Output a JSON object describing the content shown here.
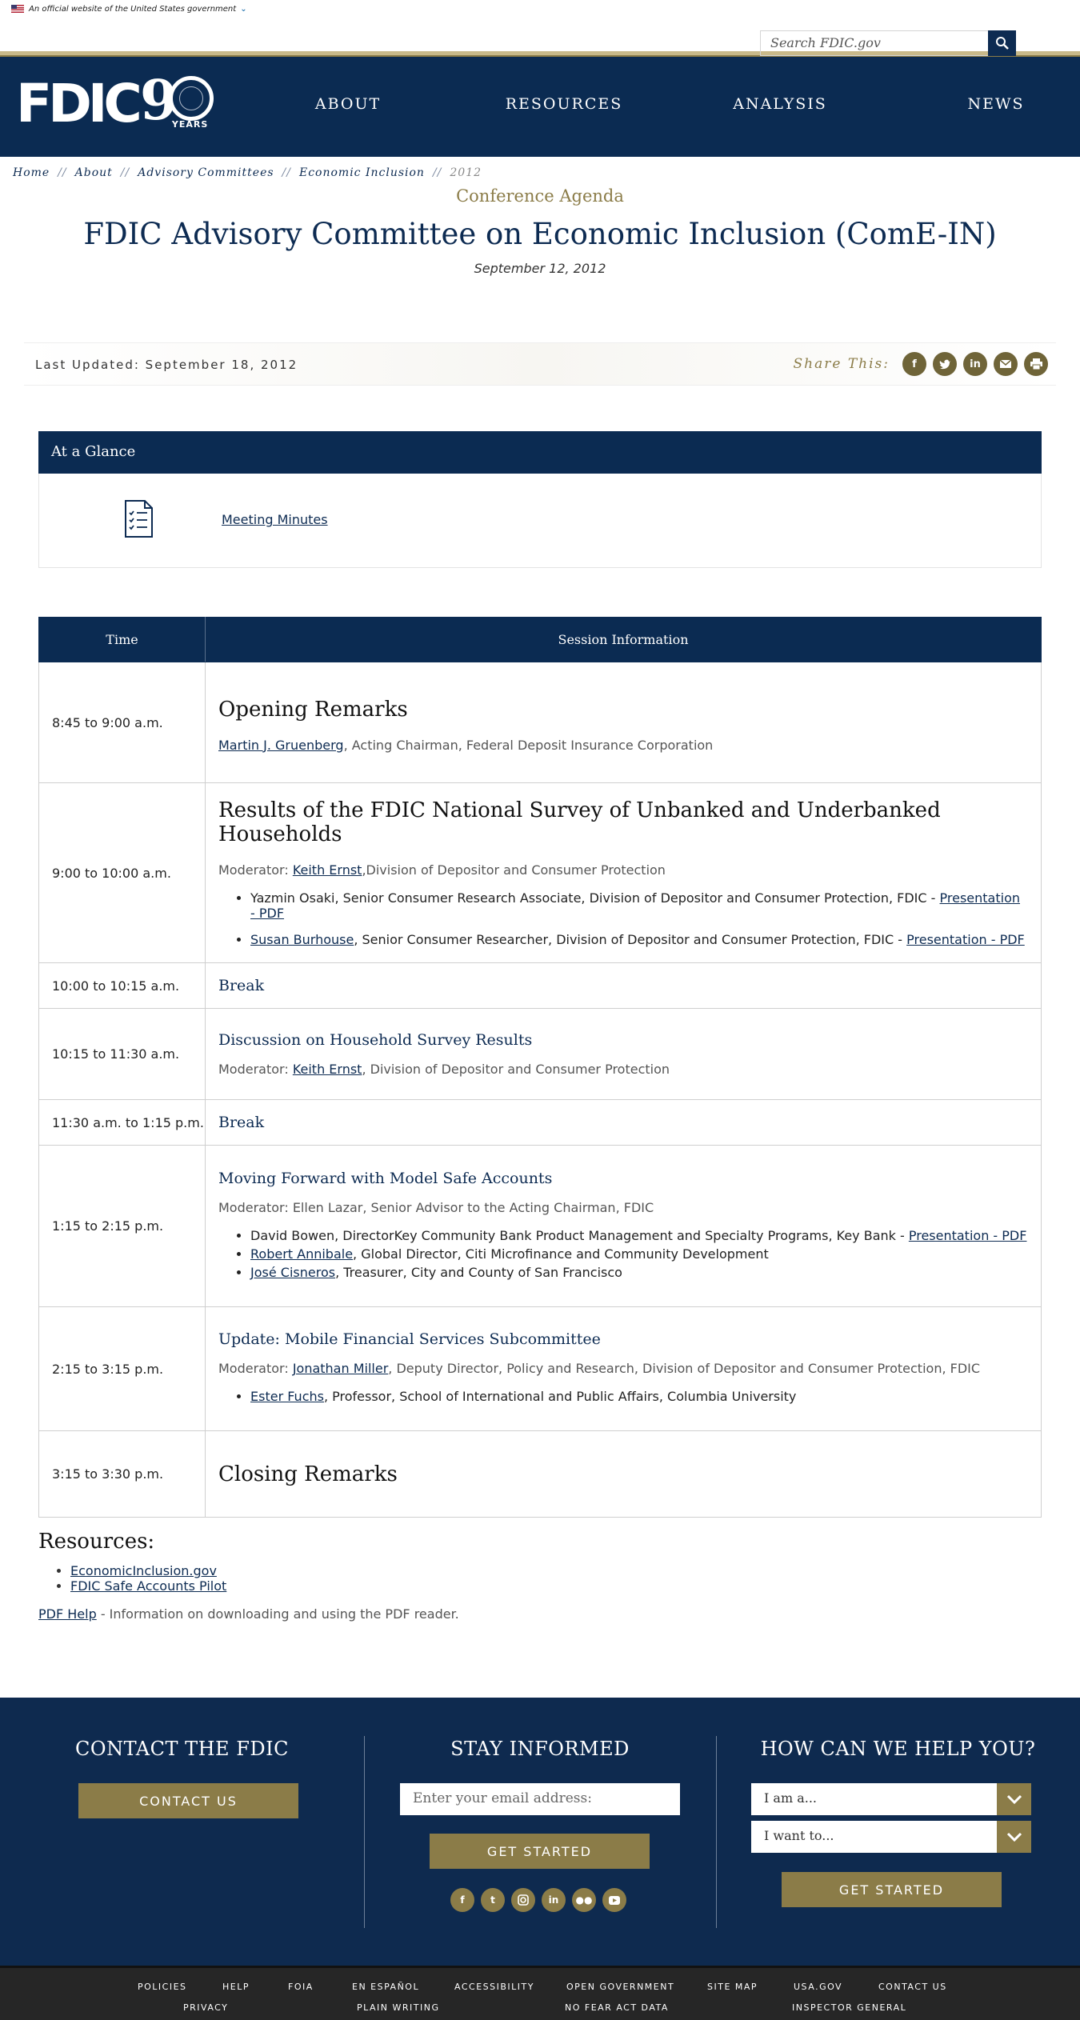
{
  "gov_banner": {
    "text": "An official website of the United States government"
  },
  "search": {
    "placeholder": "Search FDIC.gov"
  },
  "logo": {
    "text": "FDIC",
    "nine": "9",
    "years": "YEARS"
  },
  "nav": {
    "items": [
      "ABOUT",
      "RESOURCES",
      "ANALYSIS",
      "NEWS"
    ]
  },
  "breadcrumb": {
    "items": [
      "Home",
      "About",
      "Advisory Committees",
      "Economic Inclusion"
    ],
    "current": "2012",
    "separator": "//"
  },
  "page": {
    "kicker": "Conference Agenda",
    "title": "FDIC Advisory Committee on Economic Inclusion (ComE-IN)",
    "date": "September 12, 2012",
    "last_updated": "Last Updated: September 18, 2012",
    "share_label": "Share This:"
  },
  "share_icons": [
    "facebook-icon",
    "twitter-icon",
    "linkedin-icon",
    "email-icon",
    "print-icon"
  ],
  "glance": {
    "heading": "At a Glance",
    "link": "Meeting Minutes"
  },
  "agenda": {
    "col_time": "Time",
    "col_info": "Session Information",
    "rows": [
      {
        "time": "8:45 to 9:00 a.m.",
        "title": "Opening Remarks",
        "mod_link": "Martin J. Gruenberg",
        "mod_rest": ", Acting Chairman, Federal Deposit Insurance Corporation"
      },
      {
        "time": "9:00 to 10:00 a.m.",
        "title": "Results of the FDIC National Survey of Unbanked and Underbanked Households",
        "mod_pre": "Moderator: ",
        "mod_link": "Keith Ernst",
        "mod_rest": ",Division of Depositor and Consumer Protection",
        "bullets": [
          {
            "text": "Yazmin Osaki, Senior Consumer Research Associate, Division of Depositor and Consumer Protection, FDIC - ",
            "link2": "Presentation - PDF"
          },
          {
            "link1": "Susan Burhouse",
            "text": ", Senior Consumer Researcher, Division of Depositor and Consumer Protection, FDIC - ",
            "link2": "Presentation - PDF"
          }
        ]
      },
      {
        "time": "10:00 to 10:15 a.m.",
        "title": "Break"
      },
      {
        "time": "10:15 to 11:30 a.m.",
        "title": "Discussion on Household Survey Results",
        "mod_pre": "Moderator: ",
        "mod_link": "Keith Ernst",
        "mod_rest": ", Division of Depositor and Consumer Protection"
      },
      {
        "time": "11:30 a.m. to 1:15 p.m.",
        "title": "Break"
      },
      {
        "time": "1:15 to 2:15 p.m.",
        "title": "Moving Forward with Model Safe Accounts",
        "mod_text": "Moderator: Ellen Lazar, Senior Advisor to the Acting Chairman, FDIC",
        "bullets": [
          {
            "text": "David Bowen, DirectorKey Community Bank Product Management and Specialty Programs, Key Bank - ",
            "link2": "Presentation - PDF"
          },
          {
            "link1": "Robert Annibale",
            "text": ", Global Director, Citi Microfinance and Community Development"
          },
          {
            "link1": "José Cisneros",
            "text": ", Treasurer, City and County of San Francisco"
          }
        ]
      },
      {
        "time": "2:15 to 3:15 p.m.",
        "title": "Update: Mobile Financial Services Subcommittee",
        "mod_pre": "Moderator: ",
        "mod_link": "Jonathan Miller",
        "mod_rest": ", Deputy Director, Policy and Research, Division of Depositor and Consumer Protection, FDIC",
        "bullets": [
          {
            "link1": "Ester Fuchs",
            "text": ", Professor, School of International and Public Affairs, Columbia University"
          }
        ]
      },
      {
        "time": "3:15 to 3:30 p.m.",
        "title": "Closing Remarks"
      }
    ]
  },
  "resources": {
    "heading": "Resources:",
    "links": [
      "EconomicInclusion.gov",
      "FDIC Safe Accounts Pilot"
    ],
    "pdf_help_link": "PDF Help",
    "pdf_help_text": " - Information on downloading and using the PDF reader."
  },
  "footer": {
    "contact_heading": "CONTACT THE FDIC",
    "contact_button": "CONTACT US",
    "stay_heading": "STAY INFORMED",
    "email_placeholder": "Enter your email address:",
    "stay_button": "GET STARTED",
    "help_heading": "HOW CAN WE HELP YOU?",
    "select1": "I am a...",
    "select2": "I want to...",
    "help_button": "GET STARTED",
    "social": [
      "f",
      "t",
      "ig",
      "in",
      "fl",
      "yt"
    ]
  },
  "bottom_links": {
    "row1": [
      "POLICIES",
      "HELP",
      "FOIA",
      "EN ESPAÑOL",
      "ACCESSIBILITY",
      "OPEN GOVERNMENT",
      "SITE MAP",
      "USA.GOV",
      "CONTACT US"
    ],
    "row2": [
      "PRIVACY",
      "PLAIN WRITING",
      "NO FEAR ACT DATA",
      "INSPECTOR GENERAL"
    ]
  },
  "colors": {
    "navy": "#0b2b52",
    "gold": "#8b7c48",
    "footer_bg": "#0e2a4f"
  }
}
